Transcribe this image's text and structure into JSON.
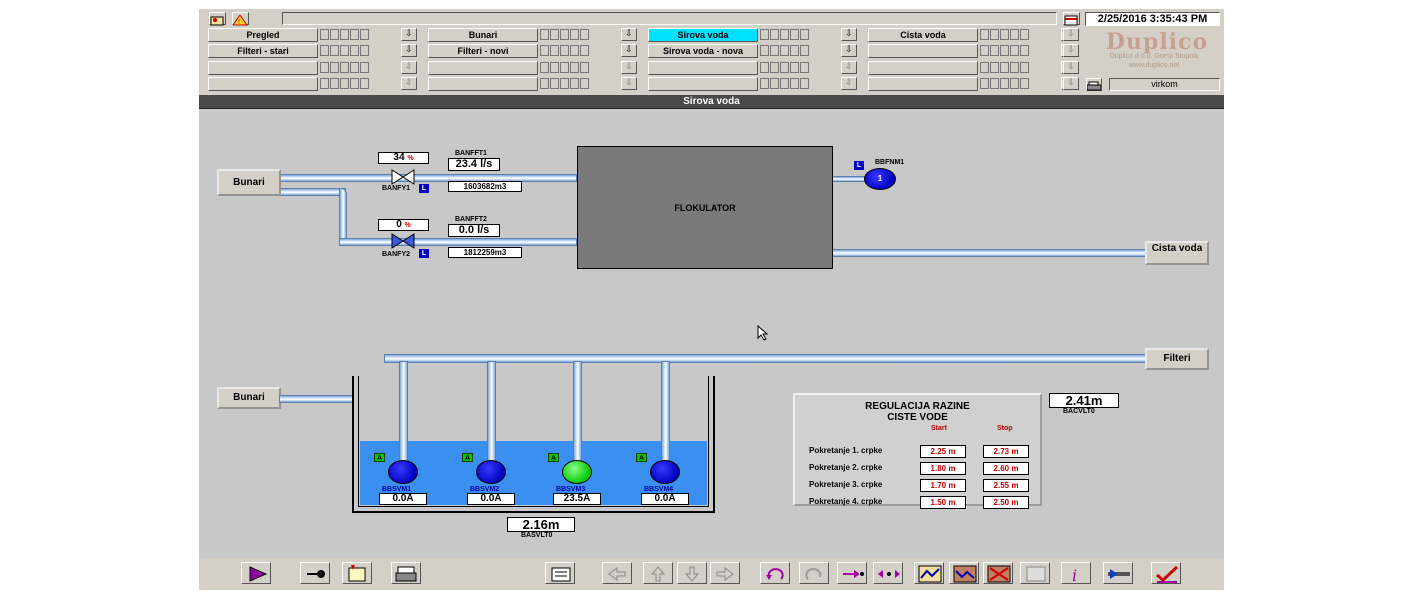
{
  "header": {
    "datetime": "2/25/2016 3:35:43 PM",
    "logo": "Duplico",
    "company": "Duplico d.o.o. Gornji Stupnik",
    "website": "www.duplico.net",
    "user": "virkom"
  },
  "nav": {
    "col1": [
      "Pregled",
      "Filteri - stari",
      "",
      ""
    ],
    "col2": [
      "Bunari",
      "Filteri - novi",
      "",
      ""
    ],
    "col3": [
      "Sirova voda",
      "Sirova voda - nova",
      "",
      ""
    ],
    "col4": [
      "Cista voda",
      "",
      "",
      ""
    ],
    "active": "Sirova voda",
    "arrow_glyph": "⇩"
  },
  "page_title": "Sirova voda",
  "process": {
    "bunari_top": "Bunari",
    "bunari_bottom": "Bunari",
    "cista_voda": "Cista voda",
    "filteri": "Filteri",
    "flokulator": "FLOKULATOR",
    "valve1": {
      "pct": "34",
      "unit": "%",
      "tag": "BANFY1",
      "mode": "L"
    },
    "valve2": {
      "pct": "0",
      "unit": "%",
      "tag": "BANFY2",
      "mode": "L"
    },
    "flow1": {
      "tag": "BANFFT1",
      "value": "23.4",
      "unit": "l/s",
      "total": "1603682m3"
    },
    "flow2": {
      "tag": "BANFFT2",
      "value": "0.0",
      "unit": "l/s",
      "total": "1812259m3"
    },
    "mixer": {
      "tag": "BBFNM1",
      "mode": "L",
      "number": "1"
    },
    "tank_level": {
      "value": "2.16",
      "unit": "m",
      "tag": "BASVLT0"
    },
    "clean_level": {
      "value": "2.41",
      "unit": "m",
      "tag": "BACVLT0"
    },
    "pumps": [
      {
        "tag": "BBSVM1",
        "mode": "A",
        "current": "0.0A",
        "running": false
      },
      {
        "tag": "BBSVM2",
        "mode": "A",
        "current": "0.0A",
        "running": false
      },
      {
        "tag": "BBSVM3",
        "mode": "A",
        "current": "23.5A",
        "running": true
      },
      {
        "tag": "BBSVM4",
        "mode": "A",
        "current": "0.0A",
        "running": false
      }
    ]
  },
  "regulation": {
    "title": "REGULACIJA RAZINE",
    "subtitle": "CISTE VODE",
    "start_label": "Start",
    "stop_label": "Stop",
    "rows": [
      {
        "label": "Pokretanje 1. crpke",
        "start": "2.25 m",
        "stop": "2.73 m"
      },
      {
        "label": "Pokretanje 2. crpke",
        "start": "1.80 m",
        "stop": "2.60 m"
      },
      {
        "label": "Pokretanje 3. crpke",
        "start": "1.70 m",
        "stop": "2.55 m"
      },
      {
        "label": "Pokretanje 4. crpke",
        "start": "1.50 m",
        "stop": "2.50 m"
      }
    ]
  },
  "toolbar": {
    "icons": [
      "play-icon",
      "key-icon",
      "alarm-notes-icon",
      "printer-stack-icon",
      "report-icon",
      "arrow-left-icon",
      "arrow-up-icon",
      "arrow-down-icon",
      "arrow-right-icon",
      "undo-icon",
      "redo-icon",
      "move-right-icon",
      "swap-icon",
      "trend-icon-1",
      "trend-icon-2",
      "trend-cancel-icon",
      "trend-disabled-icon",
      "info-icon",
      "tools-icon",
      "checkmark-icon"
    ]
  },
  "colors": {
    "active_tab": "#00e0ff",
    "water": "#3a8ff0",
    "pump_off": "#0000c0",
    "pump_on": "#00c800",
    "flokulator": "#7a7a7a",
    "setpoint_text": "#c00000"
  }
}
